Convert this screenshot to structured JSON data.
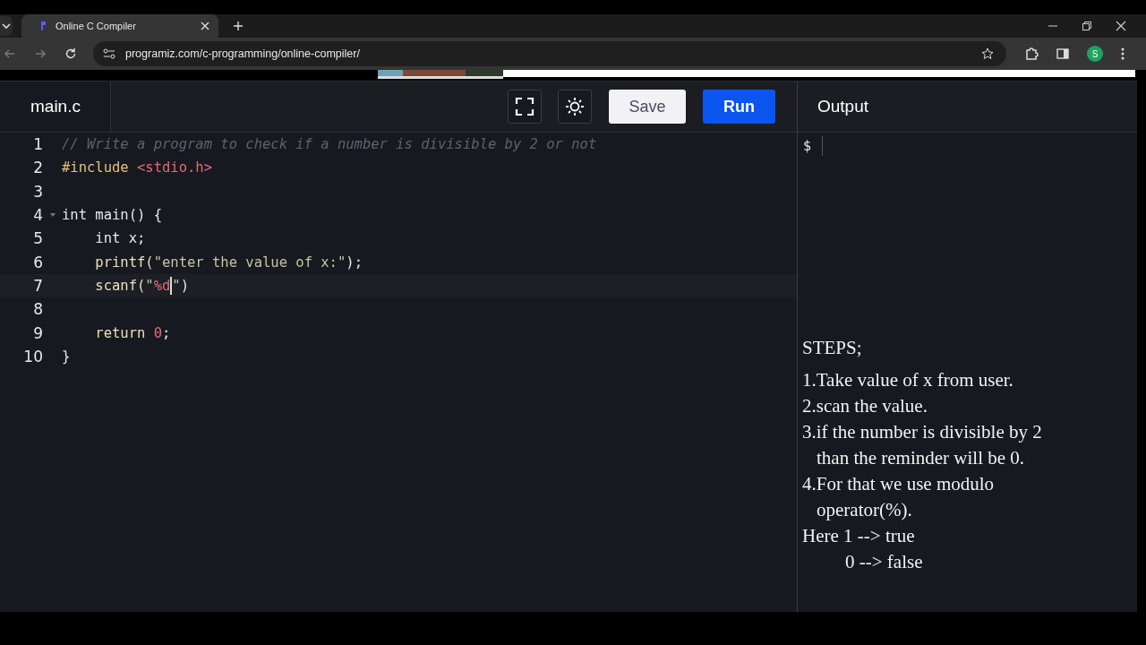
{
  "browser": {
    "tab": {
      "title": "Online C Compiler",
      "selected": true
    },
    "address": "programiz.com/c-programming/online-compiler/",
    "profile_initial": "S"
  },
  "editor": {
    "file_tab": "main.c",
    "buttons": [
      {
        "kind": "fullscreen"
      },
      {
        "kind": "theme"
      }
    ],
    "save": "Save",
    "run": "Run",
    "lines": [
      {
        "number": "1",
        "active": false,
        "foldable": false,
        "tokens": [
          {
            "kind": "comment",
            "text": "// Write a program to check if a number is divisible by 2 or not"
          }
        ]
      },
      {
        "number": "2",
        "active": false,
        "foldable": false,
        "tokens": [
          {
            "kind": "directive",
            "text": "#include "
          },
          {
            "kind": "string",
            "text": "<stdio.h>"
          }
        ]
      },
      {
        "number": "3",
        "active": false,
        "foldable": false
      },
      {
        "number": "4",
        "active": false,
        "foldable": true,
        "tokens": [
          {
            "kind": "plain",
            "text": "int main() {"
          }
        ]
      },
      {
        "number": "5",
        "active": false,
        "foldable": false,
        "tokens": [
          {
            "kind": "plain",
            "text": "    int x;"
          }
        ]
      },
      {
        "number": "6",
        "active": false,
        "foldable": false,
        "tokens": [
          {
            "kind": "func",
            "text": "    printf("
          },
          {
            "kind": "text",
            "text": "\"enter the value of x:\""
          },
          {
            "kind": "plain",
            "text": ");"
          }
        ]
      },
      {
        "number": "7",
        "active": true,
        "foldable": false,
        "tokens": [
          {
            "kind": "func",
            "text": "    scanf("
          },
          {
            "kind": "text",
            "text": "\""
          },
          {
            "kind": "string",
            "text": "%d"
          },
          {
            "kind": "cursor"
          },
          {
            "kind": "text",
            "text": "\""
          },
          {
            "kind": "plain",
            "text": ")"
          }
        ]
      },
      {
        "number": "8",
        "active": false,
        "foldable": false
      },
      {
        "number": "9",
        "active": false,
        "foldable": false,
        "tokens": [
          {
            "kind": "func",
            "text": "    return "
          },
          {
            "kind": "string",
            "text": "0"
          },
          {
            "kind": "plain",
            "text": ";"
          }
        ]
      },
      {
        "number": "10",
        "active": false,
        "foldable": false,
        "tokens": [
          {
            "kind": "plain",
            "text": "}"
          }
        ]
      }
    ]
  },
  "output": {
    "title": "Output",
    "prompt": "$",
    "notes": [
      {
        "kind": "heading",
        "text": "STEPS;"
      },
      {
        "kind": "item",
        "text": "1.Take value of x from user."
      },
      {
        "kind": "item",
        "text": "2.scan the value."
      },
      {
        "kind": "item",
        "text": "3.if the number is divisible by 2"
      },
      {
        "kind": "continuation",
        "text": "than the reminder will be 0."
      },
      {
        "kind": "item",
        "text": "4.For that we use modulo"
      },
      {
        "kind": "continuation",
        "text": "operator(%)."
      },
      {
        "kind": "item",
        "text": "Here 1 --> true"
      },
      {
        "kind": "sub",
        "text": "0 --> false"
      }
    ]
  }
}
